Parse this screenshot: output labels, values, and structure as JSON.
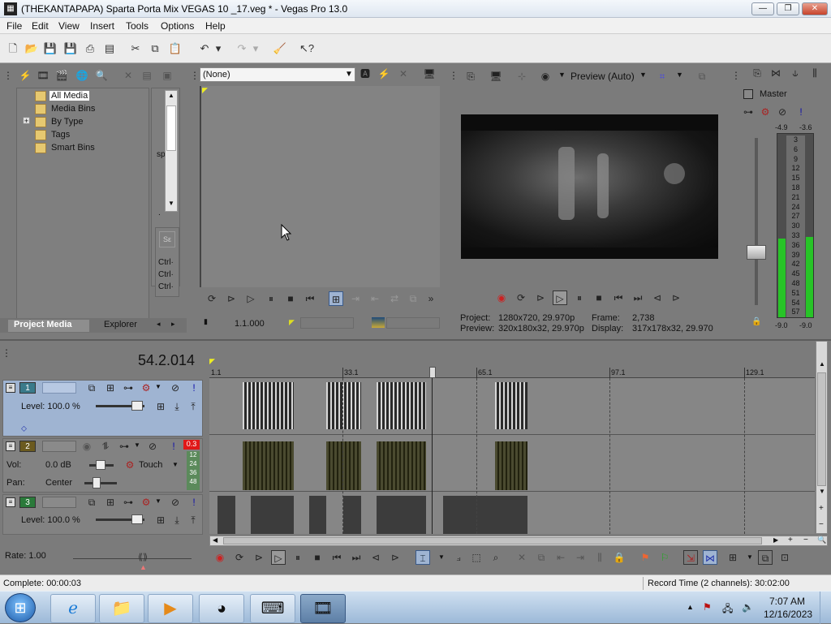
{
  "window": {
    "title": "(THEKANTAPAPA) Sparta Porta Mix VEGAS 10 _17.veg * - Vegas Pro 13.0",
    "min": "—",
    "max": "❐",
    "close": "✕"
  },
  "menu": [
    "File",
    "Edit",
    "View",
    "Insert",
    "Tools",
    "Options",
    "Help"
  ],
  "explorer": {
    "tree": [
      "All Media",
      "Media Bins",
      "By Type",
      "Tags",
      "Smart Bins"
    ],
    "expand": "+",
    "tabs": {
      "project_media": "Project Media",
      "explorer": "Explorer"
    },
    "side": {
      "sp": "sp",
      "ctrl": [
        "Ctrl·",
        "Ctrl·",
        "Ctrl·"
      ]
    }
  },
  "trimmer": {
    "dropdown": "(None)",
    "timecode": "1.1.000"
  },
  "preview": {
    "mode": "Preview (Auto)",
    "project_label": "Project:",
    "project_value": "1280x720, 29.970p",
    "preview_label": "Preview:",
    "preview_value": "320x180x32, 29.970p",
    "frame_label": "Frame:",
    "frame_value": "2,738",
    "display_label": "Display:",
    "display_value": "317x178x32, 29.970"
  },
  "master": {
    "label": "Master",
    "peak_left": "-4.9",
    "peak_right": "-3.6",
    "bottom_left": "-9.0",
    "bottom_right": "-9.0",
    "scale": [
      "3",
      "6",
      "9",
      "12",
      "15",
      "18",
      "21",
      "24",
      "27",
      "30",
      "33",
      "36",
      "39",
      "42",
      "45",
      "48",
      "51",
      "54",
      "57"
    ],
    "level_left": 0.43,
    "level_right": 0.44
  },
  "timeline": {
    "time": "54.2.014",
    "ruler": [
      "1.1",
      "33.1",
      "65.1",
      "97.1",
      "129.1"
    ],
    "track1": {
      "num": "1",
      "level": "Level: 100.0 %"
    },
    "track2": {
      "num": "2",
      "vol_label": "Vol:",
      "vol": "0.0 dB",
      "automation": "Touch",
      "pan_label": "Pan:",
      "pan": "Center",
      "peak": "0.3",
      "meter": [
        "12",
        "24",
        "36",
        "48"
      ]
    },
    "track3": {
      "num": "3",
      "level": "Level: 100.0 %"
    },
    "rate": "Rate: 1.00"
  },
  "status": {
    "complete": "Complete: 00:00:03",
    "record": "Record Time (2 channels): 30:02:00"
  },
  "taskbar": {
    "time": "7:07 AM",
    "date": "12/16/2023"
  },
  "colors": {
    "accent": "#9fb4d2",
    "meter": "#27c427",
    "record": "#cc2222"
  }
}
